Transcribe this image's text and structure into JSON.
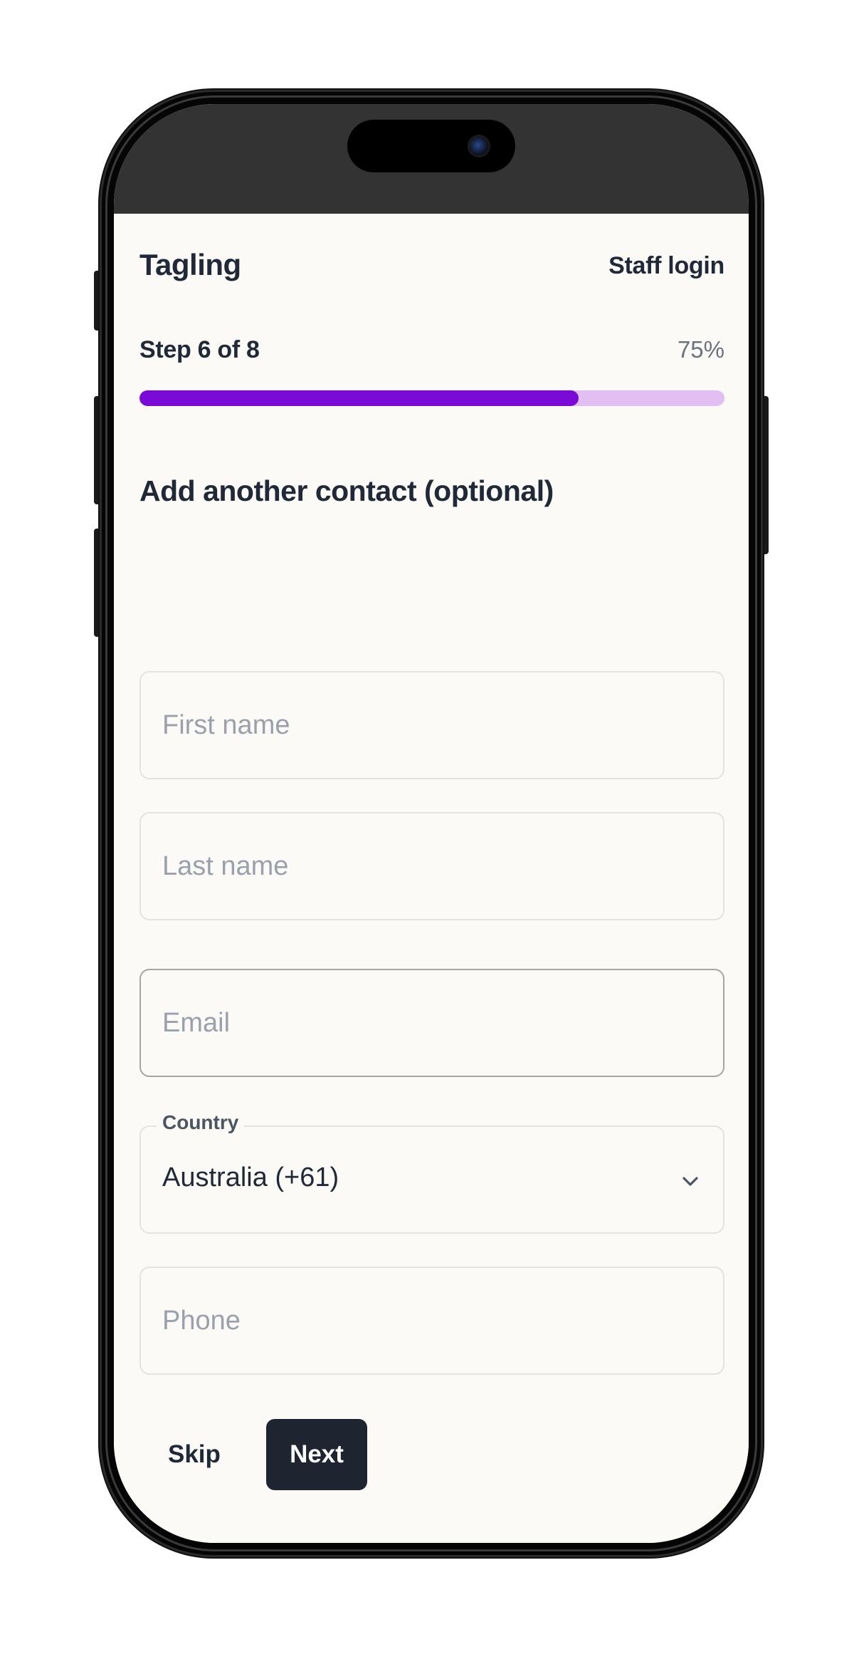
{
  "app": {
    "brand": "Tagling",
    "staff_login": "Staff login"
  },
  "progress": {
    "step_label": "Step 6 of 8",
    "percent_label": "75%",
    "percent": 75,
    "fill_color": "#7a0ad6",
    "track_color": "#e2bff2"
  },
  "form": {
    "title": "Add another contact (optional)",
    "first_name": {
      "placeholder": "First name",
      "value": ""
    },
    "last_name": {
      "placeholder": "Last name",
      "value": ""
    },
    "email": {
      "placeholder": "Email",
      "value": ""
    },
    "country": {
      "label": "Country",
      "selected": "Australia (+61)"
    },
    "phone": {
      "placeholder": "Phone",
      "value": ""
    }
  },
  "actions": {
    "skip_label": "Skip",
    "next_label": "Next"
  },
  "icons": {
    "dropdown": "chevron-down-icon",
    "camera": "front-camera-icon"
  }
}
